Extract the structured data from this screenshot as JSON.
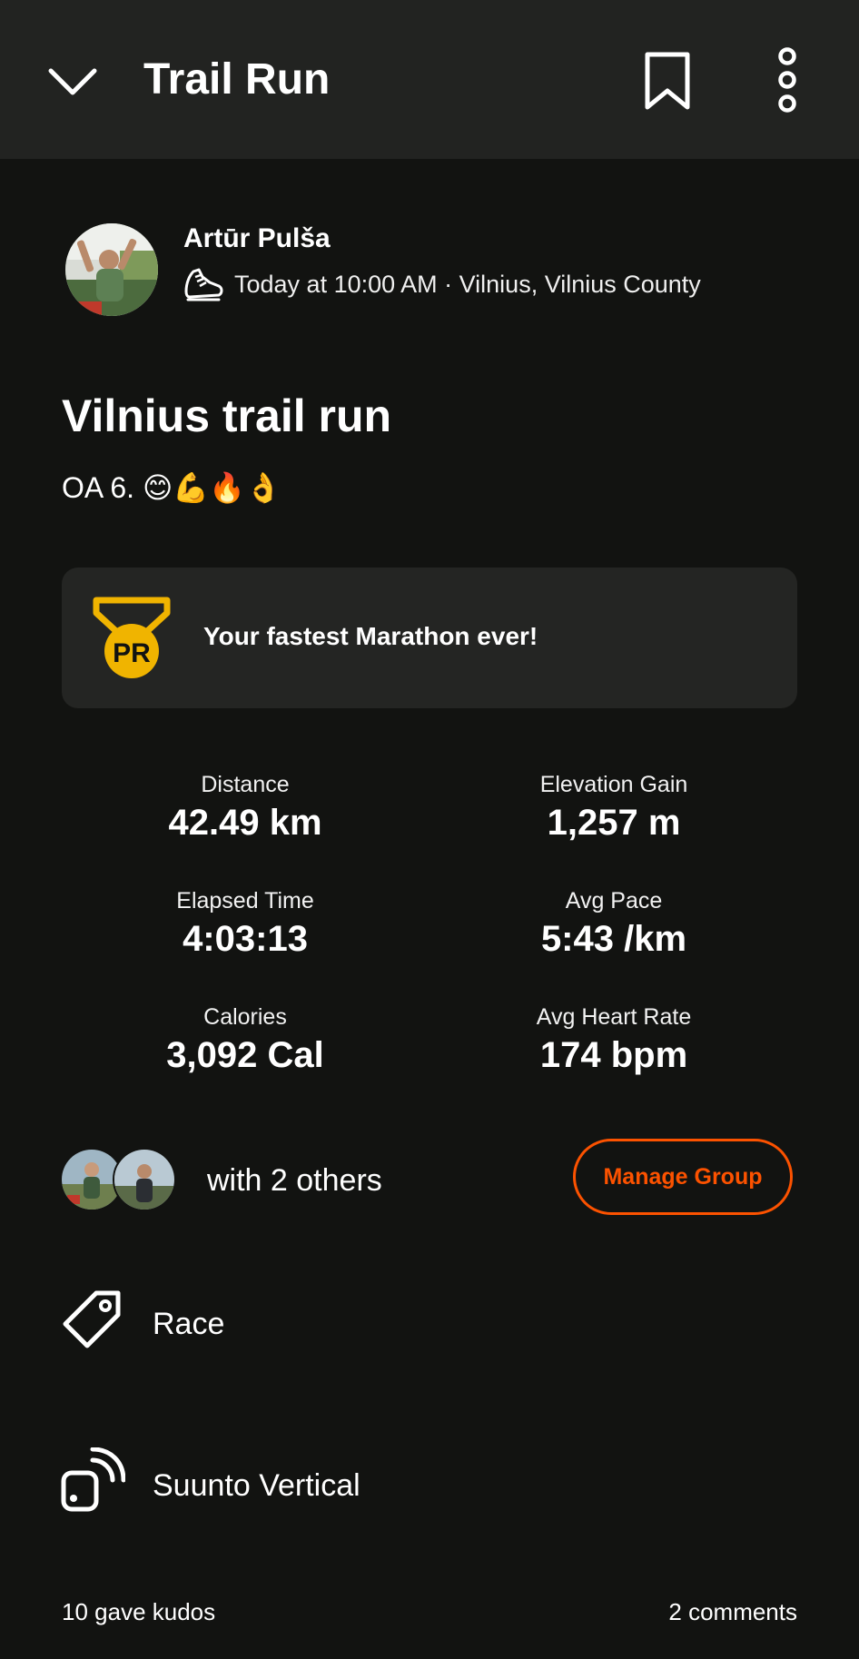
{
  "header": {
    "title": "Trail Run"
  },
  "athlete": {
    "name": "Artūr Pulša",
    "meta": "Today at 10:00 AM · Vilnius, Vilnius County"
  },
  "activity": {
    "title": "Vilnius trail run",
    "description": "OA 6. 😊💪🔥👌"
  },
  "achievement": {
    "badge": "PR",
    "text": "Your fastest Marathon ever!"
  },
  "stats": [
    {
      "label": "Distance",
      "value": "42.49 km"
    },
    {
      "label": "Elevation Gain",
      "value": "1,257 m"
    },
    {
      "label": "Elapsed Time",
      "value": "4:03:13"
    },
    {
      "label": "Avg Pace",
      "value": "5:43 /km"
    },
    {
      "label": "Calories",
      "value": "3,092 Cal"
    },
    {
      "label": "Avg Heart Rate",
      "value": "174 bpm"
    }
  ],
  "group": {
    "text": "with 2 others",
    "button_label": "Manage Group"
  },
  "tags": {
    "race_label": "Race",
    "device_label": "Suunto Vertical"
  },
  "footer": {
    "kudos": "10 gave kudos",
    "comments": "2 comments"
  },
  "colors": {
    "accent": "#fc5200",
    "medal": "#f0b400",
    "background": "#121311",
    "card": "#242523",
    "header": "#222321"
  },
  "icons": [
    "chevron-down-icon",
    "bookmark-icon",
    "more-vertical-icon",
    "running-shoe-icon",
    "pr-medal-icon",
    "tag-icon",
    "connected-device-icon"
  ]
}
